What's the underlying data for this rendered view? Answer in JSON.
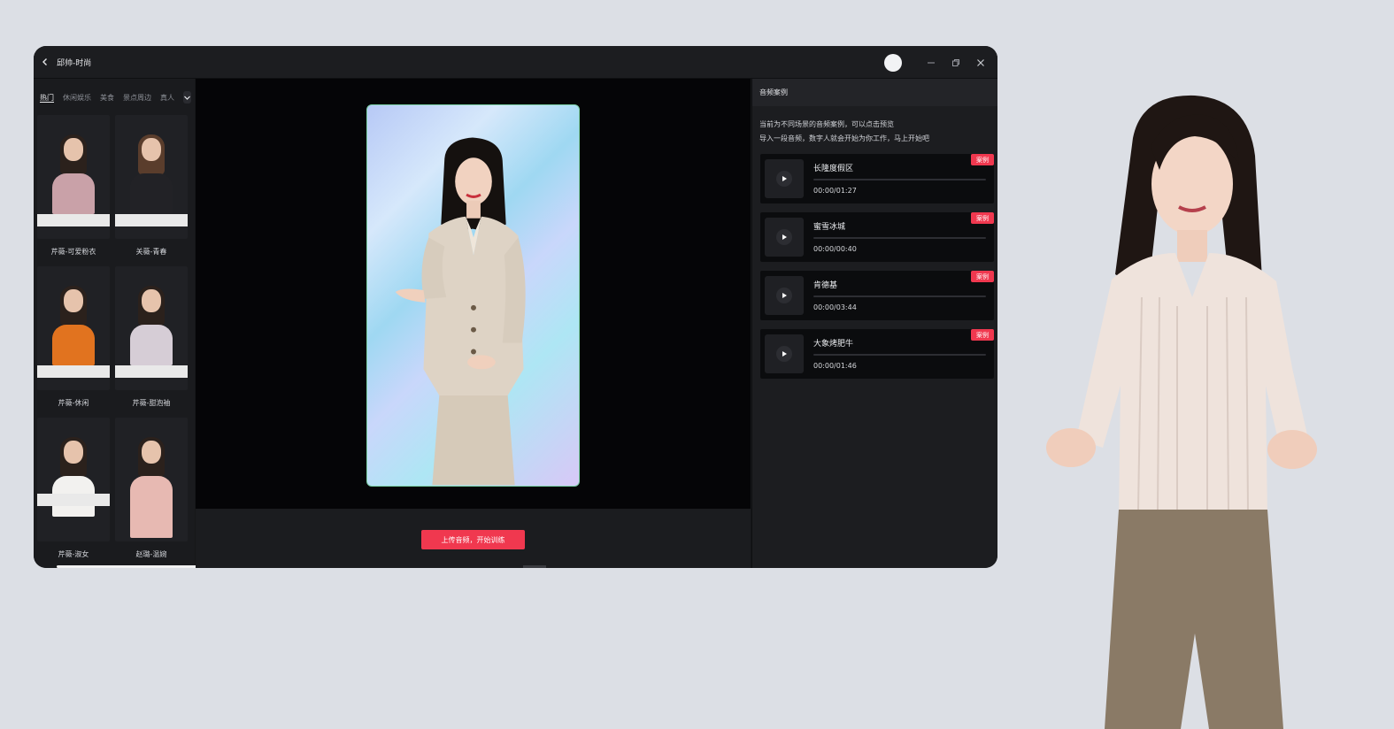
{
  "window": {
    "title": "邱帅-时尚"
  },
  "categories": {
    "tabs": [
      "热门",
      "休闲娱乐",
      "美食",
      "景点周边",
      "真人"
    ],
    "active_index": 0
  },
  "avatars": [
    {
      "label": "芹薇-可爱粉衣",
      "top_color": "#c9a1a8"
    },
    {
      "label": "关薇-青春",
      "top_color": "#222226"
    },
    {
      "label": "芹薇-休闲",
      "top_color": "#e1731f"
    },
    {
      "label": "芹薇-甜泡袖",
      "top_color": "#d6cdd6"
    },
    {
      "label": "芹薇-淑女",
      "top_color": "#f2f1ef"
    },
    {
      "label": "赵璐-温婉",
      "top_color": "#e7b9b2"
    }
  ],
  "center": {
    "cta_label": "上传音频，开始训练"
  },
  "audio_panel": {
    "header": "音频案例",
    "intro_lines": [
      "当前为不同场景的音频案例，可以点击预览",
      "导入一段音频，数字人就会开始为你工作，马上开始吧"
    ],
    "tag_label": "案例",
    "items": [
      {
        "name": "长隆度假区",
        "time": "00:00/01:27"
      },
      {
        "name": "蜜雪冰城",
        "time": "00:00/00:40"
      },
      {
        "name": "肯德基",
        "time": "00:00/03:44"
      },
      {
        "name": "大象烤肥牛",
        "time": "00:00/01:46"
      }
    ]
  },
  "colors": {
    "accent": "#f0384f",
    "window_bg": "#161719",
    "page_bg": "#dcdfe5"
  }
}
